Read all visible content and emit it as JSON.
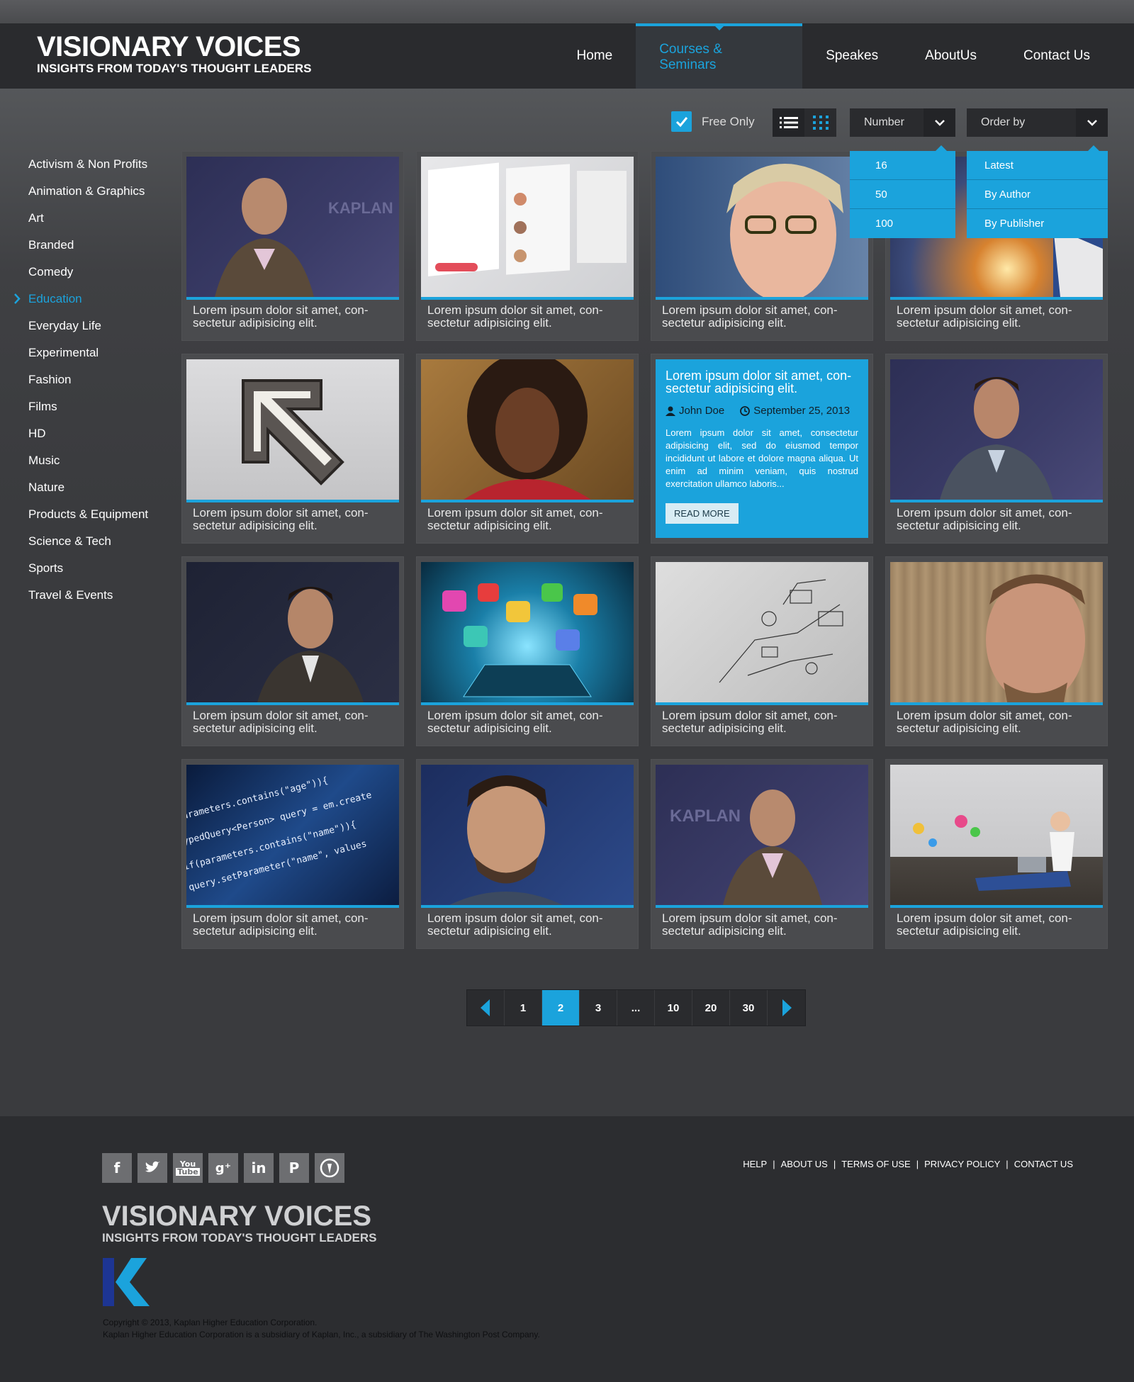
{
  "brand": {
    "title": "VISIONARY VOICES",
    "tagline": "INSIGHTS FROM TODAY'S THOUGHT LEADERS"
  },
  "nav": {
    "items": [
      "Home",
      "Courses & Seminars",
      "Speakes",
      "AboutUs",
      "Contact Us"
    ],
    "active": "Courses & Seminars"
  },
  "toolbar": {
    "free_only_label": "Free Only",
    "free_only_checked": true,
    "view_mode": "grid",
    "number_label": "Number",
    "number_options": [
      "16",
      "50",
      "100"
    ],
    "order_label": "Order by",
    "order_options": [
      "Latest",
      "By Author",
      "By Publisher"
    ]
  },
  "sidebar": {
    "items": [
      "Activism & Non Profits",
      "Animation & Graphics",
      "Art",
      "Branded",
      "Comedy",
      "Education",
      "Everyday Life",
      "Experimental",
      "Fashion",
      "Films",
      "HD",
      "Music",
      "Nature",
      "Products & Equipment",
      "Science & Tech",
      "Sports",
      "Travel & Events"
    ],
    "active": "Education"
  },
  "cards": {
    "caption_line1": "Lorem ipsum dolor sit amet, con-",
    "caption_line2": "sectetur adipisicing elit."
  },
  "feature": {
    "title_line1": "Lorem ipsum dolor sit amet, con-",
    "title_line2": "sectetur adipisicing elit.",
    "author": "John Doe",
    "date": "September 25, 2013",
    "body": "Lorem ipsum dolor sit amet, consectetur adipisicing elit, sed do eiusmod tempor incididunt ut labore et dolore magna aliqua. Ut enim ad minim veniam, quis nostrud exercitation ullamco laboris...",
    "button": "READ MORE"
  },
  "pagination": {
    "pages": [
      "1",
      "2",
      "3",
      "...",
      "10",
      "20",
      "30"
    ],
    "current": "2"
  },
  "footer": {
    "social": [
      "facebook",
      "twitter",
      "youtube",
      "google-plus",
      "linkedin",
      "pinterest",
      "other"
    ],
    "links": [
      "HELP",
      "ABOUT US",
      "TERMS OF USE",
      "PRIVACY POLICY",
      "CONTACT US"
    ],
    "copyright_line1": "Copyright © 2013, Kaplan Higher Education Corporation.",
    "copyright_line2": "Kaplan Higher Education Corporation is a subsidiary of Kaplan, Inc., a subsidiary of The Washington Post Company."
  },
  "colors": {
    "accent": "#1ba3dc",
    "header_bg": "#2a2b2e",
    "body_bg": "#3a3b3e"
  }
}
